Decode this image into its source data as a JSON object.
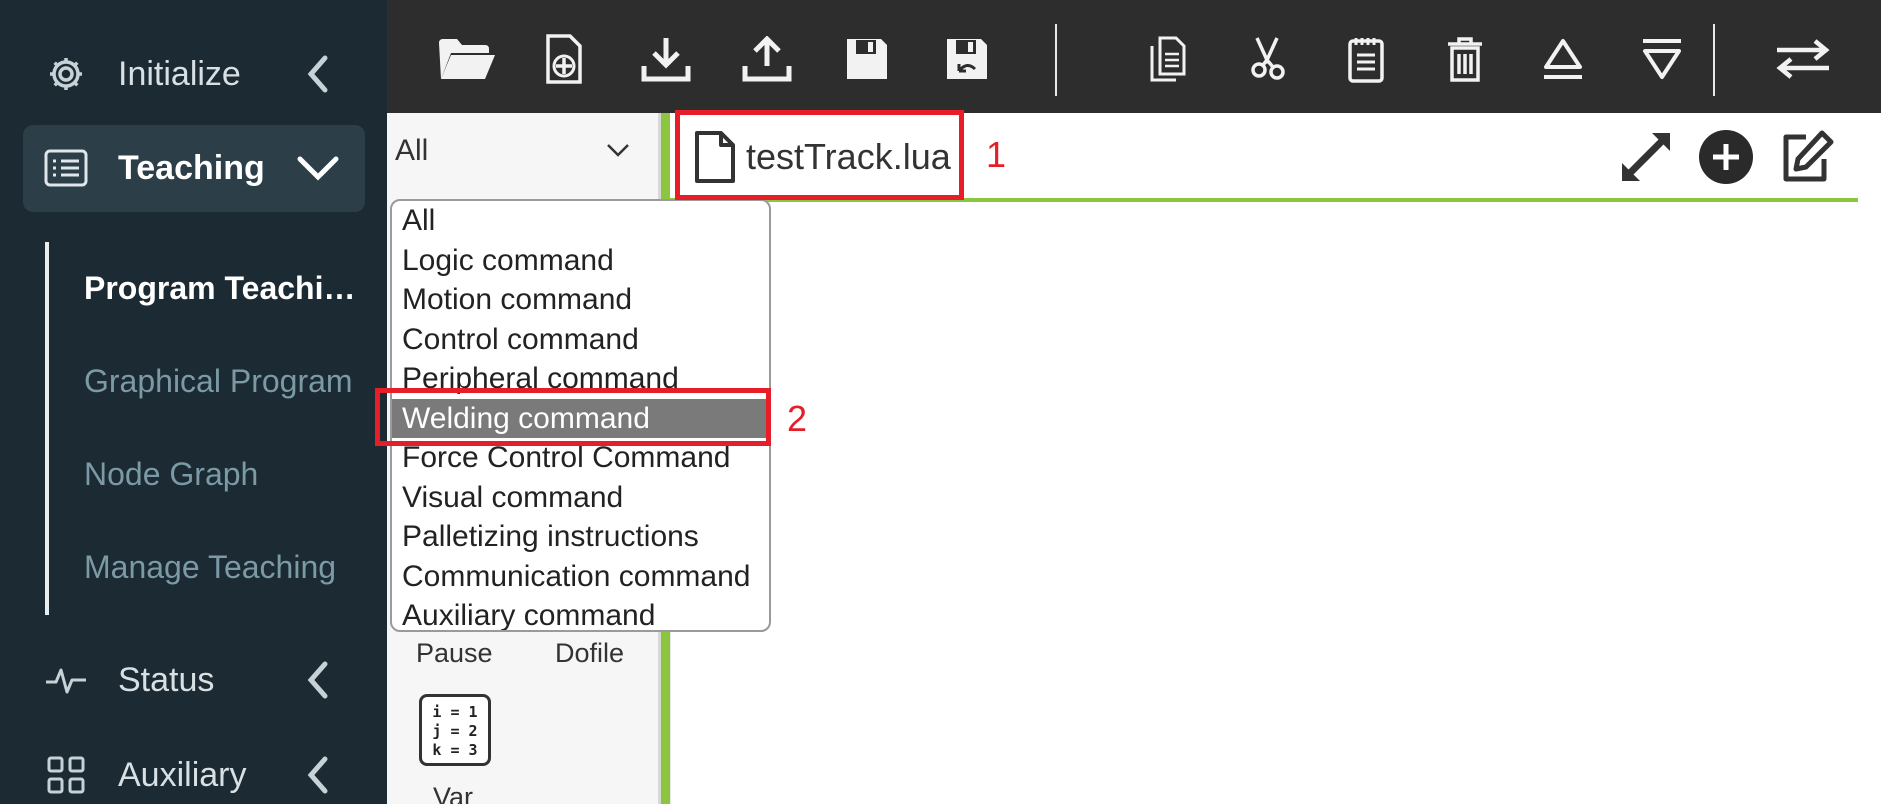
{
  "sidebar": {
    "initialize_label": "Initialize",
    "teaching_label": "Teaching",
    "sub_items": [
      "Program Teachi…",
      "Graphical Program",
      "Node Graph",
      "Manage Teaching"
    ],
    "status_label": "Status",
    "auxiliary_label": "Auxiliary"
  },
  "toolbar": {
    "buttons": [
      "open-folder-icon",
      "new-file-icon",
      "download-icon",
      "upload-icon",
      "save-icon",
      "save-as-icon",
      "copy-icon",
      "cut-icon",
      "paste-icon",
      "delete-icon",
      "move-up-icon",
      "move-down-icon",
      "switch-icon"
    ]
  },
  "command_panel": {
    "filter_value": "All",
    "tiles": [
      "Pause",
      "Dofile",
      "Var"
    ],
    "var_icon_text": [
      "i = 1",
      "j = 2",
      "k = 3"
    ]
  },
  "dropdown": {
    "options": [
      "All",
      "Logic command",
      "Motion command",
      "Control command",
      "Peripheral command",
      "Welding command",
      "Force Control Command",
      "Visual command",
      "Palletizing instructions",
      "Communication command",
      "Auxiliary command"
    ],
    "selected": "Welding command"
  },
  "editor": {
    "file_name": "testTrack.lua"
  },
  "annotations": {
    "label_1": "1",
    "label_2": "2"
  },
  "colors": {
    "sidebar_bg": "#1b2a33",
    "toolbar_bg": "#2d2d2d",
    "accent_green": "#8cc63f",
    "annotation_red": "#e61e2a",
    "selected_option_bg": "#7a7a7a"
  }
}
